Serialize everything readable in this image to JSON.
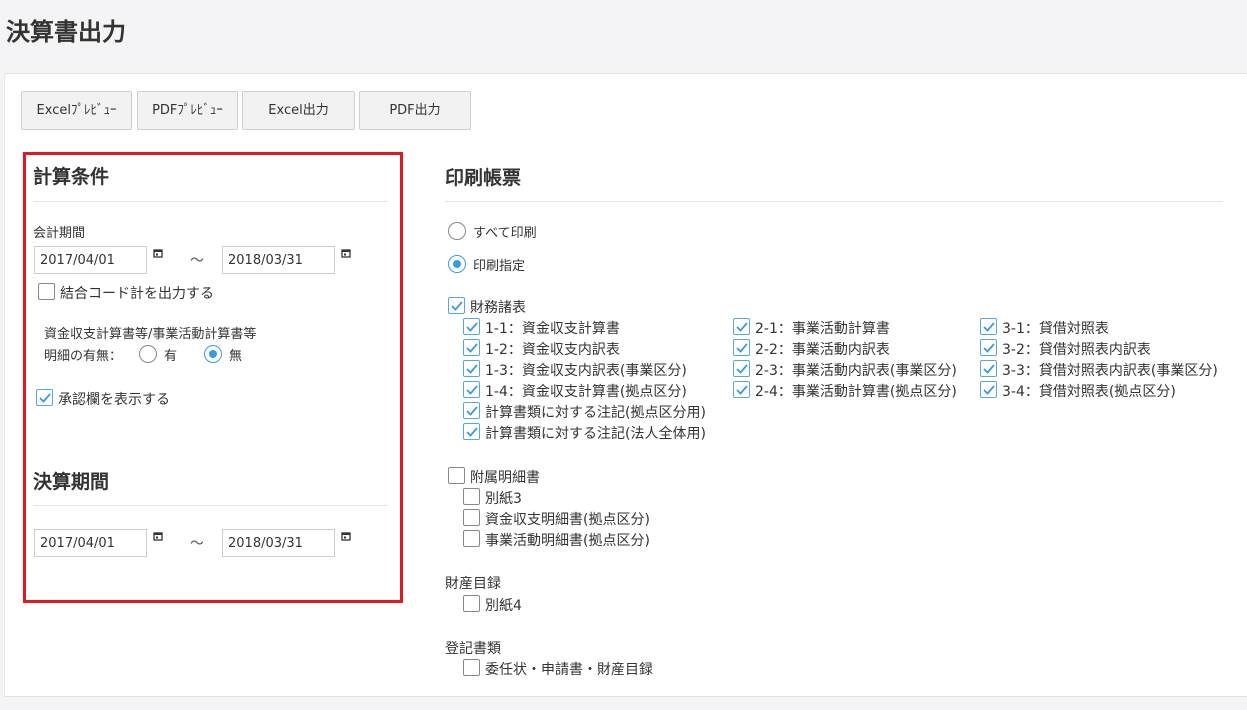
{
  "page": {
    "title": "決算書出力"
  },
  "toolbar": {
    "excel_preview": "Excelﾌﾟﾚﾋﾞｭｰ",
    "pdf_preview": "PDFﾌﾟﾚﾋﾞｭｰ",
    "excel_output": "Excel出力",
    "pdf_output": "PDF出力"
  },
  "calc_conditions": {
    "title": "計算条件",
    "fiscal_period_label": "会計期間",
    "start_date": "2017/04/01",
    "end_date": "2018/03/31",
    "tilde": "～",
    "combined_code_label": "結合コード計を出力する",
    "combined_code_checked": false,
    "detail_heading": "資金収支計算書等/事業活動計算書等",
    "detail_label": "明細の有無：",
    "detail_yes": "有",
    "detail_no": "無",
    "detail_selected": "無",
    "approval_label": "承認欄を表示する",
    "approval_checked": true
  },
  "settlement_period": {
    "title": "決算期間",
    "start_date": "2017/04/01",
    "end_date": "2018/03/31",
    "tilde": "～"
  },
  "print_forms": {
    "title": "印刷帳票",
    "print_all": "すべて印刷",
    "print_specify": "印刷指定",
    "selected_mode": "印刷指定",
    "financial_statements": {
      "label": "財務諸表",
      "checked": true,
      "col1": [
        "1-1：資金収支計算書",
        "1-2：資金収支内訳表",
        "1-3：資金収支内訳表(事業区分)",
        "1-4：資金収支計算書(拠点区分)",
        "計算書類に対する注記(拠点区分用)",
        "計算書類に対する注記(法人全体用)"
      ],
      "col2": [
        "2-1：事業活動計算書",
        "2-2：事業活動内訳表",
        "2-3：事業活動内訳表(事業区分)",
        "2-4：事業活動計算書(拠点区分)"
      ],
      "col3": [
        "3-1：貸借対照表",
        "3-2：貸借対照表内訳表",
        "3-3：貸借対照表内訳表(事業区分)",
        "3-4：貸借対照表(拠点区分)"
      ]
    },
    "attached_statements": {
      "label": "附属明細書",
      "items": [
        "別紙3",
        "資金収支明細書(拠点区分)",
        "事業活動明細書(拠点区分)"
      ]
    },
    "property_list": {
      "label": "財産目録",
      "items": [
        "別紙4"
      ]
    },
    "registration_docs": {
      "label": "登記書類",
      "items": [
        "委任状・申請書・財産目録"
      ]
    }
  }
}
